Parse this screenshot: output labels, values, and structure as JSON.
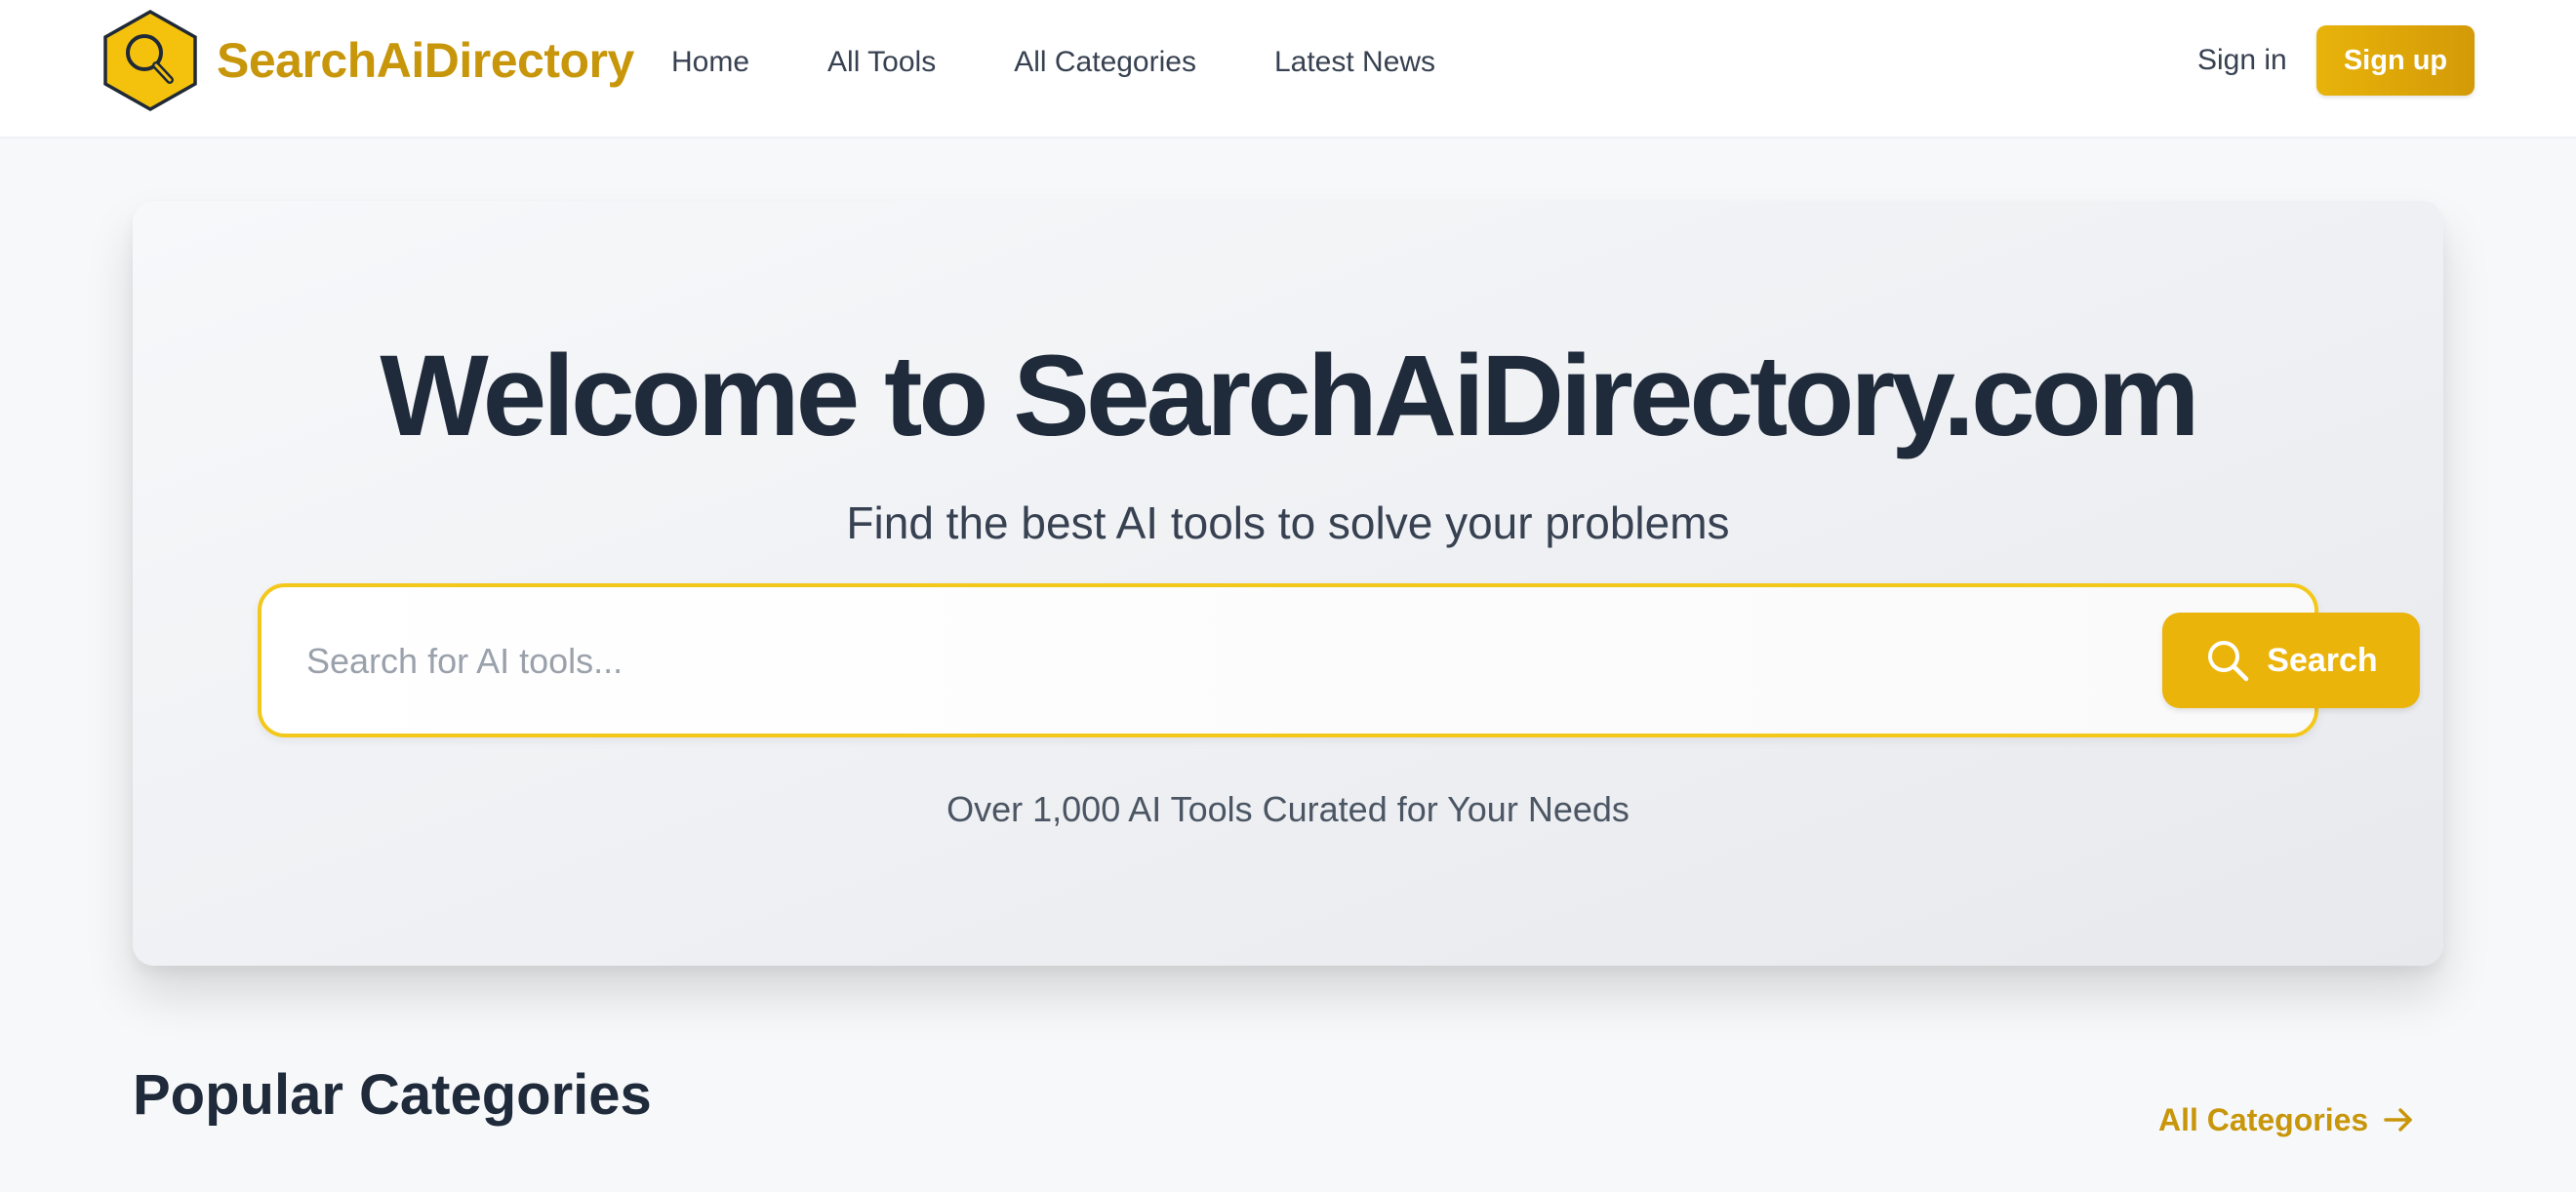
{
  "header": {
    "logo_text": "SearchAiDirectory",
    "nav": [
      "Home",
      "All Tools",
      "All Categories",
      "Latest News"
    ],
    "signin_label": "Sign in",
    "signup_label": "Sign up"
  },
  "hero": {
    "title": "Welcome to SearchAiDirectory.com",
    "subtitle": "Find the best AI tools to solve your problems",
    "search_placeholder": "Search for AI tools...",
    "search_button_label": "Search",
    "caption": "Over 1,000 AI Tools Curated for Your Needs"
  },
  "categories": {
    "title": "Popular Categories",
    "all_link_label": "All Categories"
  },
  "icons": {
    "logo": "hexagon-magnifier-icon",
    "search": "search-icon",
    "arrow": "arrow-right-icon"
  },
  "colors": {
    "accent": "#ebb40b",
    "accent_dark": "#c8960a",
    "heading": "#1f2a3a"
  }
}
